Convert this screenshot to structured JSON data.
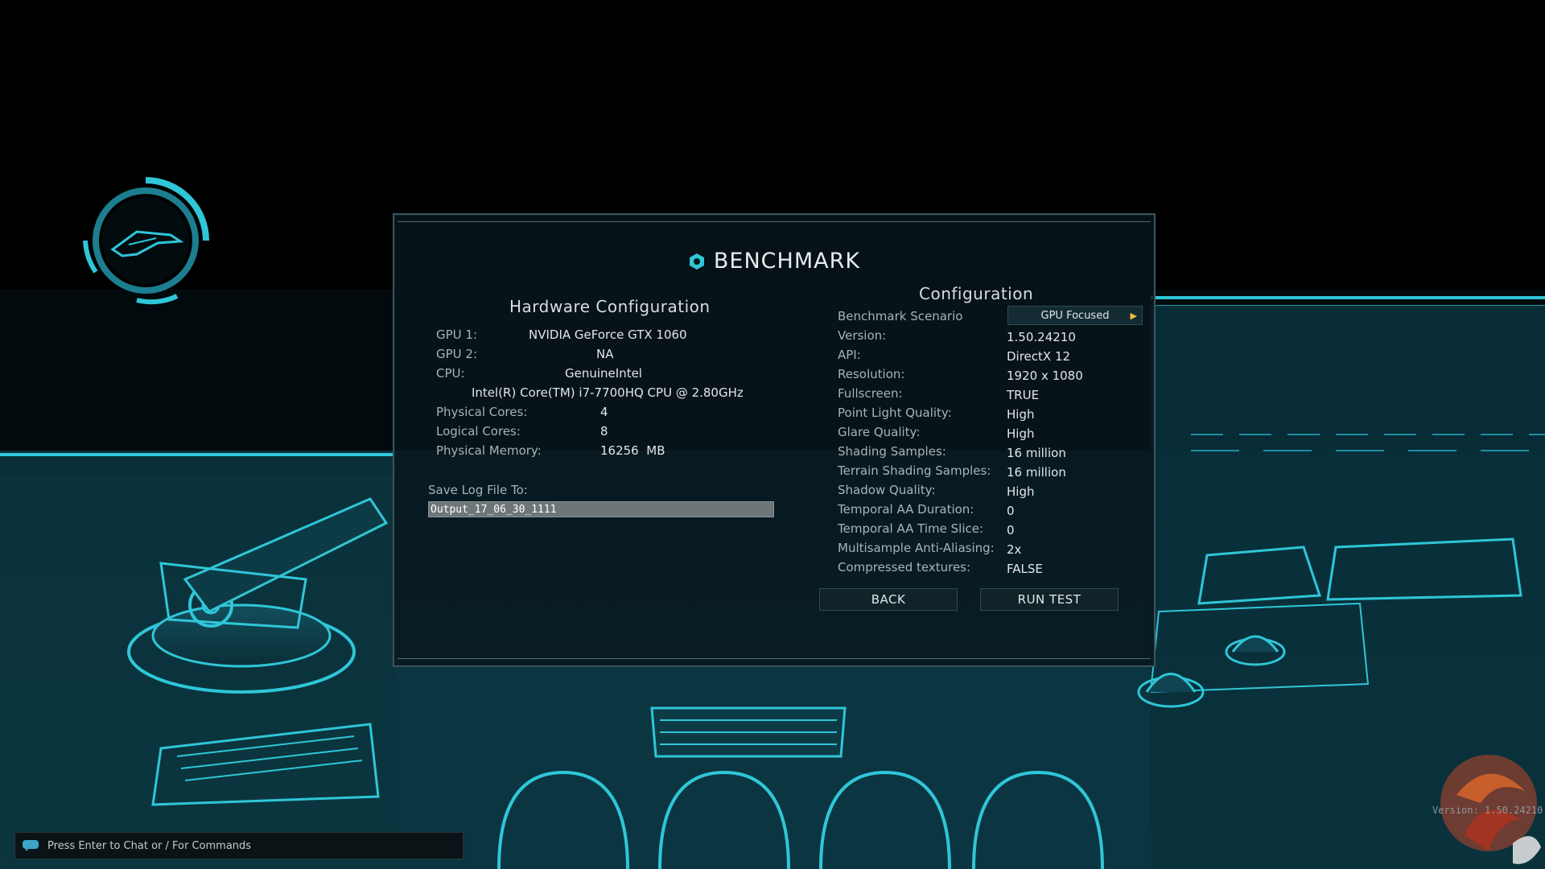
{
  "dialog": {
    "title": "BENCHMARK",
    "hardware": {
      "heading": "Hardware Configuration",
      "rows": [
        {
          "label": "GPU 1:",
          "value": "NVIDIA GeForce GTX 1060"
        },
        {
          "label": "GPU 2:",
          "value": "NA"
        },
        {
          "label": "CPU:",
          "value": "GenuineIntel"
        },
        {
          "label": "",
          "value": "Intel(R) Core(TM) i7-7700HQ CPU @ 2.80GHz"
        },
        {
          "label": "Physical Cores:",
          "value": "4"
        },
        {
          "label": "Logical Cores:",
          "value": "8"
        },
        {
          "label": "Physical Memory:",
          "value": "16256  MB"
        }
      ],
      "save_label": "Save Log File To:",
      "save_value": "Output_17_06_30_1111"
    },
    "configuration": {
      "heading": "Configuration",
      "scenario_label": "Benchmark Scenario",
      "scenario_value": "GPU Focused",
      "rows": [
        {
          "label": "Version:",
          "value": "1.50.24210"
        },
        {
          "label": "API:",
          "value": "DirectX 12"
        },
        {
          "label": "Resolution:",
          "value": "1920 x 1080"
        },
        {
          "label": "Fullscreen:",
          "value": "TRUE"
        },
        {
          "label": "Point Light Quality:",
          "value": "High"
        },
        {
          "label": "Glare Quality:",
          "value": "High"
        },
        {
          "label": "Shading Samples:",
          "value": "16 million"
        },
        {
          "label": "Terrain Shading Samples:",
          "value": "16 million"
        },
        {
          "label": "Shadow Quality:",
          "value": "High"
        },
        {
          "label": "Temporal AA Duration:",
          "value": "0"
        },
        {
          "label": "Temporal AA Time Slice:",
          "value": "0"
        },
        {
          "label": "Multisample Anti-Aliasing:",
          "value": "2x"
        },
        {
          "label": "Compressed textures:",
          "value": "FALSE"
        }
      ]
    },
    "buttons": {
      "back": "BACK",
      "run_test": "RUN TEST"
    }
  },
  "chat": {
    "prompt": "Press Enter to Chat or / For Commands"
  },
  "watermark": {
    "version": "Version: 1.50.24210"
  },
  "colors": {
    "accent_cyan": "#2fc6d8",
    "dialog_bg": "#08161c",
    "dropdown_arrow": "#f2c140"
  }
}
